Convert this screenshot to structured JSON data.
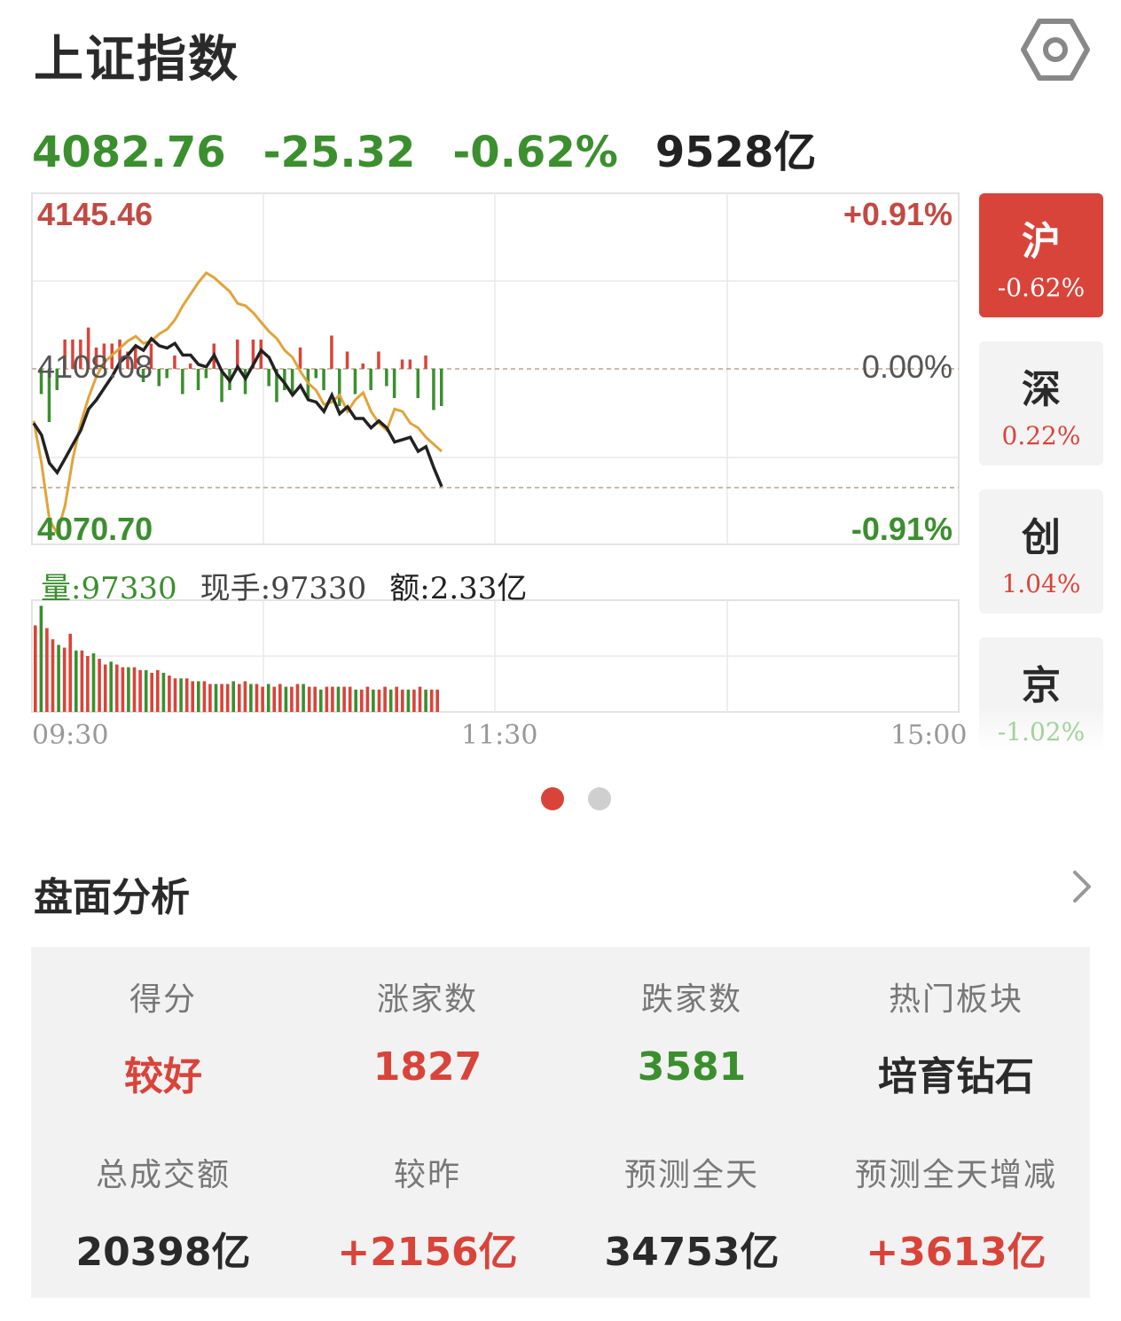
{
  "header": {
    "title": "上证指数"
  },
  "quote": {
    "price": "4082.76",
    "change": "-25.32",
    "change_pct": "-0.62%",
    "turnover": "9528亿"
  },
  "colors": {
    "up": "#d9443a",
    "down": "#3b8f2e",
    "avg_line": "#e0a43a",
    "price_line": "#222222"
  },
  "chart_labels": {
    "high": "4145.46",
    "high_pct": "+0.91%",
    "prev_close": "4108.08",
    "zero_pct": "0.00%",
    "low": "4070.70",
    "low_pct": "-0.91%",
    "time_start": "09:30",
    "time_mid": "11:30",
    "time_end": "15:00"
  },
  "volume_info": {
    "vol_label": "量:97330",
    "hand_label": "现手:97330",
    "amount_label": "额:2.33亿"
  },
  "markets": [
    {
      "name": "沪",
      "pct": "-0.62%",
      "active": true
    },
    {
      "name": "深",
      "pct": "0.22%",
      "active": false
    },
    {
      "name": "创",
      "pct": "1.04%",
      "active": false
    },
    {
      "name": "京",
      "pct": "-1.02%",
      "active": false
    }
  ],
  "analysis": {
    "title": "盘面分析",
    "items": [
      {
        "label": "得分",
        "value": "较好",
        "tone": "red"
      },
      {
        "label": "涨家数",
        "value": "1827",
        "tone": "red"
      },
      {
        "label": "跌家数",
        "value": "3581",
        "tone": "green"
      },
      {
        "label": "热门板块",
        "value": "培育钻石",
        "tone": "dark"
      },
      {
        "label": "总成交额",
        "value": "20398亿",
        "tone": "dark"
      },
      {
        "label": "较昨",
        "value": "+2156亿",
        "tone": "red"
      },
      {
        "label": "预测全天",
        "value": "34753亿",
        "tone": "dark"
      },
      {
        "label": "预测全天增减",
        "value": "+3613亿",
        "tone": "red"
      }
    ]
  },
  "chart_data": {
    "type": "line",
    "ylim": [
      4070.7,
      4145.46
    ],
    "prev_close": 4108.08,
    "minutes_total": 240,
    "series": [
      {
        "name": "price",
        "values": [
          4096.5,
          4094.0,
          4088.0,
          4086.0,
          4089.0,
          4092.0,
          4095.0,
          4099.5,
          4101.5,
          4104.0,
          4106.5,
          4109.5,
          4111.0,
          4113.0,
          4112.0,
          4114.5,
          4113.0,
          4112.5,
          4113.5,
          4111.0,
          4111.0,
          4109.0,
          4108.5,
          4111.0,
          4107.5,
          4105.5,
          4108.5,
          4106.0,
          4109.0,
          4112.0,
          4110.5,
          4107.0,
          4105.0,
          4102.5,
          4104.5,
          4101.5,
          4101.0,
          4099.0,
          4102.5,
          4098.5,
          4100.0,
          4097.5,
          4097.5,
          4095.5,
          4097.0,
          4095.5,
          4092.5,
          4093.0,
          4093.5,
          4090.5,
          4091.5,
          4087.0,
          4083.0
        ]
      },
      {
        "name": "avg",
        "values": [
          4097.0,
          4088.0,
          4076.0,
          4073.0,
          4079.0,
          4089.0,
          4096.5,
          4102.0,
          4106.5,
          4109.5,
          4111.0,
          4112.5,
          4114.0,
          4115.0,
          4113.5,
          4114.0,
          4115.5,
          4116.5,
          4118.5,
          4121.5,
          4124.0,
          4126.5,
          4128.5,
          4127.5,
          4126.0,
          4124.5,
          4122.0,
          4121.5,
          4120.0,
          4118.0,
          4116.0,
          4114.5,
          4112.0,
          4110.5,
          4107.5,
          4105.0,
          4103.5,
          4100.5,
          4101.0,
          4102.5,
          4099.0,
          4101.5,
          4103.0,
          4099.0,
          4096.5,
          4095.0,
          4099.5,
          4099.0,
          4096.5,
          4095.5,
          4093.5,
          4092.0,
          4090.5
        ]
      }
    ],
    "volume": [
      31,
      38,
      30,
      26,
      24,
      23,
      28,
      22,
      22,
      20,
      21,
      19,
      17,
      18,
      17,
      16,
      16,
      16,
      15,
      15,
      14,
      15,
      14,
      13,
      12,
      12,
      12,
      11,
      11,
      11,
      10,
      10,
      10,
      10,
      11,
      10,
      11,
      10,
      10,
      9,
      10,
      9,
      10,
      9,
      9,
      10,
      10,
      9,
      9,
      8,
      9,
      9,
      9,
      9,
      9,
      8,
      8,
      9,
      8,
      8,
      9,
      8,
      9,
      8,
      8,
      8,
      9,
      8,
      8,
      8
    ],
    "volume_ylim": [
      0,
      40
    ]
  }
}
